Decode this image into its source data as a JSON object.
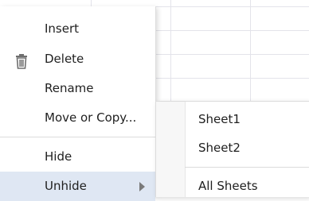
{
  "context_menu": {
    "items": [
      {
        "label": "Insert"
      },
      {
        "label": "Delete",
        "icon": "trash-icon"
      },
      {
        "label": "Rename"
      },
      {
        "label": "Move or Copy..."
      },
      {
        "label": "Hide"
      },
      {
        "label": "Unhide",
        "has_submenu": true,
        "highlighted": true
      }
    ]
  },
  "submenu": {
    "items": [
      {
        "label": "Sheet1"
      },
      {
        "label": "Sheet2"
      },
      {
        "label": "All Sheets"
      }
    ]
  },
  "colors": {
    "highlight": "#dfe7f3",
    "separator": "#dcdcdc",
    "grid": "#e3e3ea"
  }
}
